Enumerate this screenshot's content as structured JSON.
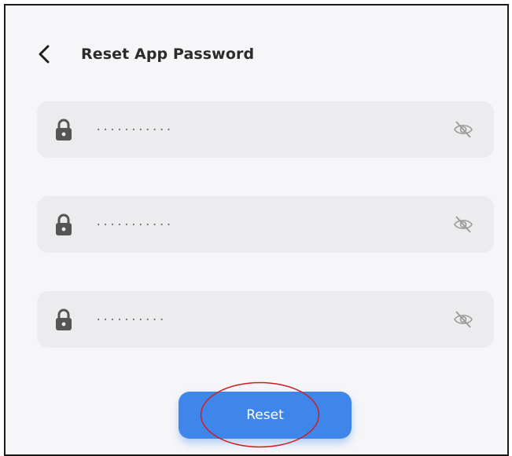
{
  "header": {
    "title": "Reset App Password",
    "back_icon": "chevron-left-icon"
  },
  "fields": [
    {
      "value": "···········",
      "lock_icon": "lock-icon",
      "toggle_icon": "eye-off-icon"
    },
    {
      "value": "···········",
      "lock_icon": "lock-icon",
      "toggle_icon": "eye-off-icon"
    },
    {
      "value": "··········",
      "lock_icon": "lock-icon",
      "toggle_icon": "eye-off-icon"
    }
  ],
  "reset_button": {
    "label": "Reset"
  },
  "colors": {
    "accent": "#3f86ea",
    "background": "#f6f6f9",
    "field_background": "#ececee",
    "annotation": "#cc1f1f"
  }
}
